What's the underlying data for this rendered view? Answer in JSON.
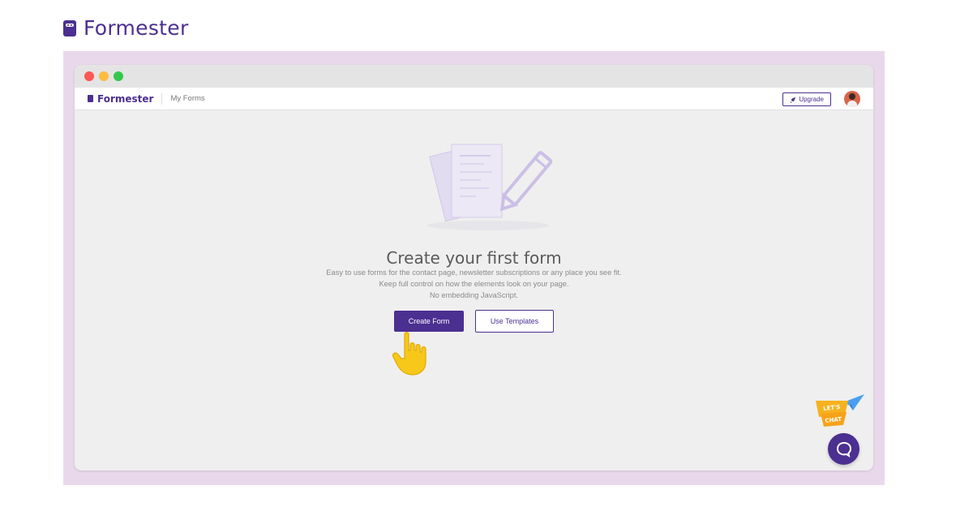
{
  "brand": {
    "name": "Formester"
  },
  "app": {
    "brand": "Formester",
    "nav_link": "My Forms",
    "upgrade_label": "Upgrade"
  },
  "empty_state": {
    "title": "Create your first form",
    "lines": [
      "Easy to use forms for the contact page, newsletter subscriptions or any place you see fit.",
      "Keep full control on how the elements look on your page.",
      "No embedding JavaScript."
    ],
    "create_label": "Create Form",
    "templates_label": "Use Templates"
  },
  "chat": {
    "badge_text_1": "LET'S",
    "badge_text_2": "CHAT"
  },
  "icons": {
    "brand": "form-logo-icon",
    "upgrade": "rocket-icon",
    "avatar": "user-avatar",
    "pointer": "pointing-hand-icon",
    "chat": "chat-bubble-icon",
    "plane": "paper-plane-icon"
  },
  "colors": {
    "brand": "#4b2f91",
    "frame": "#e9d8eb",
    "window_bg": "#efefef",
    "hand": "#f7c81a"
  }
}
